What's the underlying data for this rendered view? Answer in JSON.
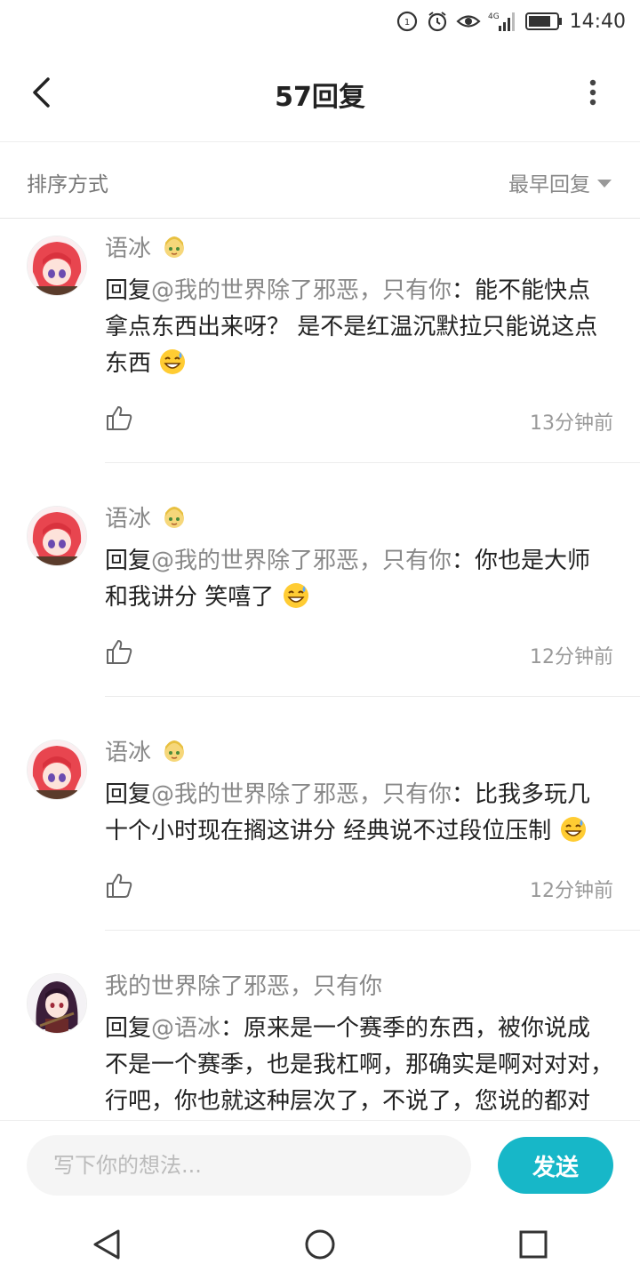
{
  "status_bar": {
    "time": "14:40",
    "network": "4G",
    "icons": [
      "hd-call-icon",
      "alarm-icon",
      "eye-icon",
      "signal-icon",
      "battery-icon"
    ]
  },
  "header": {
    "title": "57回复",
    "back_icon": "chevron-left-icon",
    "more_icon": "more-vertical-icon"
  },
  "sort": {
    "label": "排序方式",
    "value": "最早回复"
  },
  "comments": [
    {
      "author": "语冰",
      "reply_prefix": "回复",
      "mention": "@我的世界除了邪恶，只有你",
      "separator": "：",
      "text": "能不能快点拿点东西出来呀？ 是不是红温沉默拉只能说这点东西",
      "emoji": "grinning-sweat-emoji",
      "time": "13分钟前"
    },
    {
      "author": "语冰",
      "reply_prefix": "回复",
      "mention": "@我的世界除了邪恶，只有你",
      "separator": "：",
      "text": "你也是大师和我讲分 笑嘻了",
      "emoji": "grinning-sweat-emoji",
      "time": "12分钟前"
    },
    {
      "author": "语冰",
      "reply_prefix": "回复",
      "mention": "@我的世界除了邪恶，只有你",
      "separator": "：",
      "text": "比我多玩几十个小时现在搁这讲分 经典说不过段位压制",
      "emoji": "grinning-sweat-emoji",
      "time": "12分钟前"
    },
    {
      "author": "我的世界除了邪恶，只有你",
      "reply_prefix": "回复",
      "mention": "@语冰",
      "separator": "：",
      "text": "原来是一个赛季的东西，被你说成不是一个赛季，也是我杠啊，那确实是啊对对对，行吧，你也就这种层次了，不说了，您说的都对",
      "emoji": "",
      "time": ""
    }
  ],
  "composer": {
    "placeholder": "写下你的想法...",
    "send_label": "发送"
  },
  "colors": {
    "accent": "#17b7c8",
    "text_primary": "#222222",
    "text_secondary": "#888888"
  }
}
